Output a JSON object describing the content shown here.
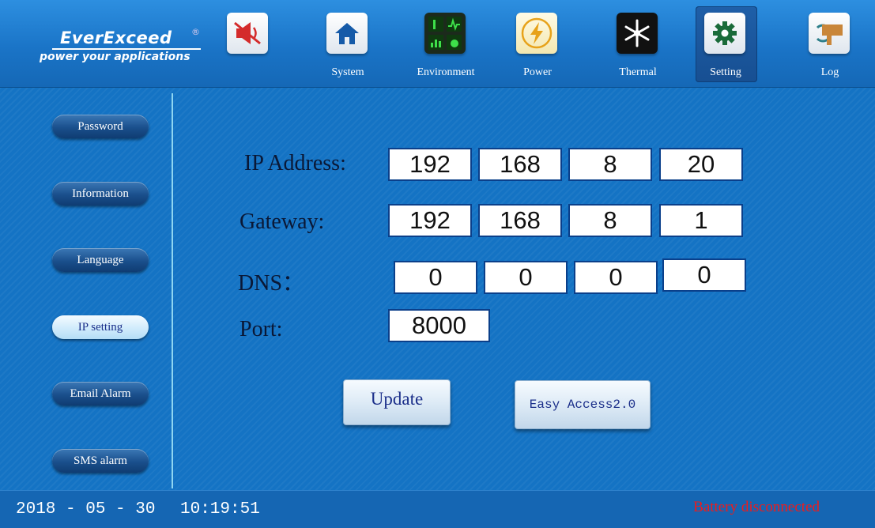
{
  "brand": {
    "name": "EverExceed",
    "reg_mark": "®",
    "tagline": "power your applications"
  },
  "nav": {
    "mute_icon": "mute-speaker-icon",
    "items": [
      {
        "label": "System",
        "icon": "home-icon"
      },
      {
        "label": "Environment",
        "icon": "environment-monitor-icon"
      },
      {
        "label": "Power",
        "icon": "lightning-icon"
      },
      {
        "label": "Thermal",
        "icon": "snowflake-icon"
      },
      {
        "label": "Setting",
        "icon": "gear-icon",
        "active": true
      },
      {
        "label": "Log",
        "icon": "log-icon"
      }
    ]
  },
  "sidebar": {
    "items": [
      {
        "label": "Password"
      },
      {
        "label": "Information"
      },
      {
        "label": "Language"
      },
      {
        "label": "IP setting",
        "active": true
      },
      {
        "label": "Email Alarm"
      },
      {
        "label": "SMS alarm"
      }
    ]
  },
  "form": {
    "ip_label": "IP Address:",
    "ip": [
      "192",
      "168",
      "8",
      "20"
    ],
    "gateway_label": "Gateway:",
    "gateway": [
      "192",
      "168",
      "8",
      "1"
    ],
    "dns_label": "DNS：",
    "dns": [
      "0",
      "0",
      "0",
      "0"
    ],
    "port_label": "Port:",
    "port": "8000"
  },
  "actions": {
    "update_label": "Update",
    "easy_access_label": "Easy Access2.0"
  },
  "status": {
    "date": "2018 - 05 - 30",
    "time": "10:19:51",
    "alert": "Battery disconnected"
  },
  "colors": {
    "background": "#1473c4",
    "alert": "#ef1b1b",
    "field_border": "#0a3f8a"
  }
}
